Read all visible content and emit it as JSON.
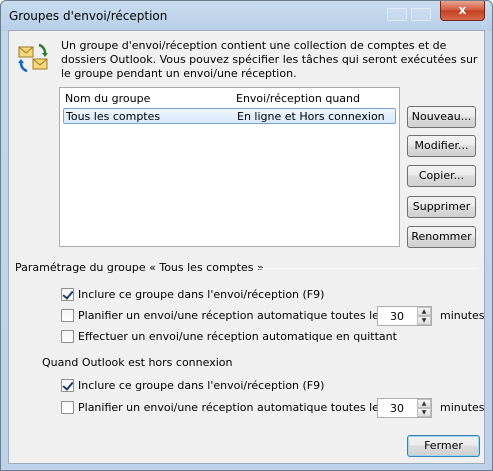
{
  "window": {
    "title": "Groupes d'envoi/réception",
    "close_glyph": "x"
  },
  "intro": {
    "icon": "send-receive-groups-icon",
    "text": "Un groupe d'envoi/réception contient une collection de comptes et de dossiers Outlook. Vous pouvez spécifier les tâches qui seront exécutées sur le groupe pendant un envoi/une réception."
  },
  "groups_list": {
    "columns": [
      "Nom du groupe",
      "Envoi/réception quand"
    ],
    "rows": [
      {
        "name": "Tous les comptes",
        "when": "En ligne et Hors connexion",
        "selected": true
      }
    ]
  },
  "buttons": {
    "new": "Nouveau...",
    "edit": "Modifier...",
    "copy": "Copier...",
    "delete": "Supprimer",
    "rename": "Renommer",
    "close": "Fermer"
  },
  "group_settings": {
    "heading": "Paramétrage du groupe « Tous les comptes »",
    "include_online": {
      "label": "Inclure ce groupe dans l'envoi/réception (F9)",
      "checked": true
    },
    "schedule_online": {
      "label": "Planifier un envoi/une réception automatique toutes les",
      "checked": false,
      "value": "30",
      "unit": "minutes"
    },
    "on_exit": {
      "label": "Effectuer un envoi/une réception automatique en quittant",
      "checked": false
    }
  },
  "offline_settings": {
    "heading": "Quand Outlook est hors connexion",
    "include_offline": {
      "label": "Inclure ce groupe dans l'envoi/réception (F9)",
      "checked": true
    },
    "schedule_offline": {
      "label": "Planifier un envoi/une réception automatique toutes les",
      "checked": false,
      "value": "30",
      "unit": "minutes"
    }
  },
  "colors": {
    "title_gradient_top": "#c9dcef",
    "selection_border": "#7da2ce",
    "close_red": "#c03e21"
  }
}
